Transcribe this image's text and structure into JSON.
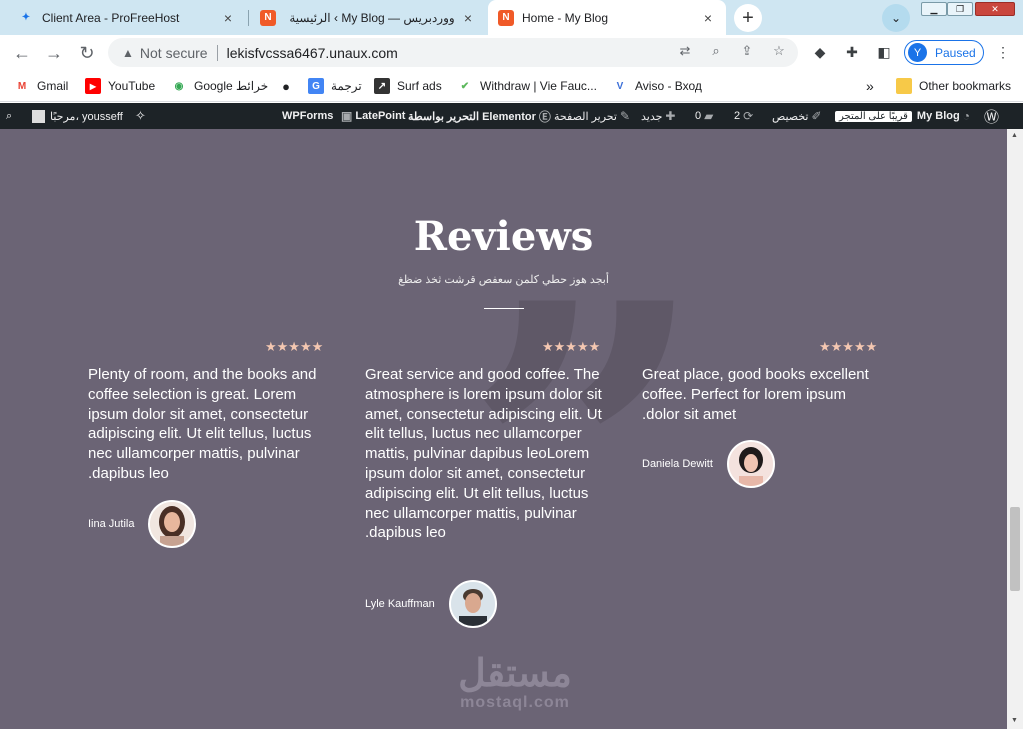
{
  "tabs": [
    {
      "title": "Client Area - ProFreeHost",
      "icon": "pfh-icon",
      "active": false
    },
    {
      "title": "الرئيسية ‹ My Blog — ووردبريس",
      "icon": "wordpress-n-icon",
      "active": false
    },
    {
      "title": "Home - My Blog",
      "icon": "wordpress-n-icon",
      "active": true
    }
  ],
  "tab_close": "×",
  "new_tab": "+",
  "browser": {
    "not_secure": "Not secure",
    "url": "lekisfvcssa6467.unaux.com",
    "profile_initial": "Y",
    "profile_status": "Paused"
  },
  "bookmarks": [
    "Gmail",
    "YouTube",
    "Google خرائط",
    "ترجمة",
    "Surf ads",
    "Withdraw | Vie Fauc...",
    "Aviso - Вход"
  ],
  "bookmarks_more": "»",
  "other_bookmarks": "Other bookmarks",
  "adminbar": {
    "greeting": "مرحبًا، yousseff",
    "wpforms": "WPForms",
    "latepoint": "LatePoint",
    "elementor": "التحرير بواسطة Elementor",
    "edit_page": "تحرير الصفحة",
    "new": "جديد",
    "comments": "0",
    "updates": "2",
    "customize": "تخصيص",
    "coming_soon": "قريبًا على المتجر",
    "site_name": "My Blog"
  },
  "section": {
    "title": "Reviews",
    "subtitle": "أبجد هوز حطي كلمن سعفص قرشت ثخذ ضظغ"
  },
  "reviews": [
    {
      "stars": 5,
      "stars_text": "★★★★★",
      "text": "Plenty of room, and the books and coffee selection is great. Lorem ipsum dolor sit amet, consectetur adipiscing elit. Ut elit tellus, luctus nec ullamcorper mattis, pulvinar .dapibus leo",
      "author": "Iina Jutila"
    },
    {
      "stars": 5,
      "stars_text": "★★★★★",
      "text": "Great service and good coffee. The atmosphere is lorem ipsum dolor sit amet, consectetur adipiscing elit. Ut elit tellus, luctus nec ullamcorper mattis, pulvinar dapibus leoLorem ipsum dolor sit amet, consectetur adipiscing elit. Ut elit tellus, luctus nec ullamcorper mattis, pulvinar .dapibus leo",
      "author": "Lyle Kauffman"
    },
    {
      "stars": 5,
      "stars_text": "★★★★★",
      "text": "Great place, good books excellent coffee. Perfect for lorem ipsum .dolor sit amet",
      "author": "Daniela Dewitt"
    }
  ],
  "watermark": {
    "arabic": "مستقل",
    "latin": "mostaql.com"
  },
  "colors": {
    "page_bg": "#6b6475",
    "star": "#f4c7b1",
    "adminbar": "#1d2327",
    "tabstrip": "#cfe6f2"
  }
}
